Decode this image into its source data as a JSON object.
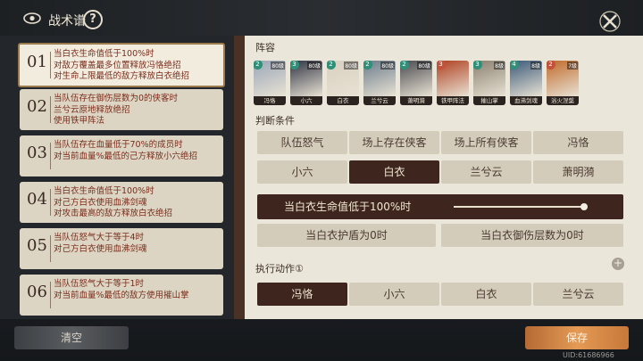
{
  "header": {
    "title": "战术谱",
    "help_glyph": "?"
  },
  "slots": [
    {
      "num": "01",
      "lines": [
        "当白衣生命值低于100%时",
        "对敌方覆盖最多位置释放冯恪绝招",
        "对生命上限最低的敌方释放白衣绝招"
      ],
      "selected": true
    },
    {
      "num": "02",
      "lines": [
        "当队伍存在御伤层数为0的侠客时",
        "兰兮云原地释放绝招",
        "使用铁甲阵法"
      ]
    },
    {
      "num": "03",
      "lines": [
        "当队伍存在血量低于70%的成员时",
        "对当前血量%最低的己方释放小六绝招"
      ]
    },
    {
      "num": "04",
      "lines": [
        "当白衣生命值低于100%时",
        "对己方白衣使用血沸剑魂",
        "对攻击最高的敌方释放白衣绝招"
      ]
    },
    {
      "num": "05",
      "lines": [
        "当队伍怒气大于等于4时",
        "对己方白衣使用血沸剑魂"
      ]
    },
    {
      "num": "06",
      "lines": [
        "当队伍怒气大于等于1时",
        "对当前血量%最低的敌方使用摧山掌"
      ]
    }
  ],
  "lineup": {
    "label": "阵容",
    "cards": [
      {
        "name": "冯恪",
        "cost": "2",
        "lv": "80级",
        "color": "#9aa6b8",
        "red": false
      },
      {
        "name": "小六",
        "cost": "3",
        "lv": "80级",
        "color": "#2f3344",
        "red": false
      },
      {
        "name": "白衣",
        "cost": "2",
        "lv": "80级",
        "color": "#d8d0c0",
        "red": false
      },
      {
        "name": "兰兮云",
        "cost": "2",
        "lv": "80级",
        "color": "#6b7c8c",
        "red": false
      },
      {
        "name": "萧明漪",
        "cost": "2",
        "lv": "80级",
        "color": "#4a4a50",
        "red": false
      },
      {
        "name": "铁甲阵法",
        "cost": "3",
        "lv": "",
        "color": "#b04020",
        "red": true
      },
      {
        "name": "摧山掌",
        "cost": "3",
        "lv": "8级",
        "color": "#8a8070",
        "red": false
      },
      {
        "name": "血沸剑魂",
        "cost": "4",
        "lv": "8级",
        "color": "#3b5a7a",
        "red": false
      },
      {
        "name": "浴火涅槃",
        "cost": "2",
        "lv": "7级",
        "color": "#c06a2a",
        "red": true
      }
    ]
  },
  "conditions": {
    "label": "判断条件",
    "row1": [
      "队伍怒气",
      "场上存在侠客",
      "场上所有侠客",
      "冯恪"
    ],
    "row2": [
      "小六",
      "白衣",
      "兰兮云",
      "萧明漪"
    ],
    "selected_row2": 1,
    "slider_text": "当白衣生命值低于100%时",
    "slider_fraction": 1.0,
    "sub": [
      "当白衣护盾为0时",
      "当白衣御伤层数为0时"
    ]
  },
  "actions": {
    "label": "执行动作",
    "info_glyph": "①",
    "items": [
      "冯恪",
      "小六",
      "白衣",
      "兰兮云"
    ],
    "selected": 0
  },
  "footer": {
    "clear": "清空",
    "save": "保存",
    "uid": "UID:61686966"
  }
}
